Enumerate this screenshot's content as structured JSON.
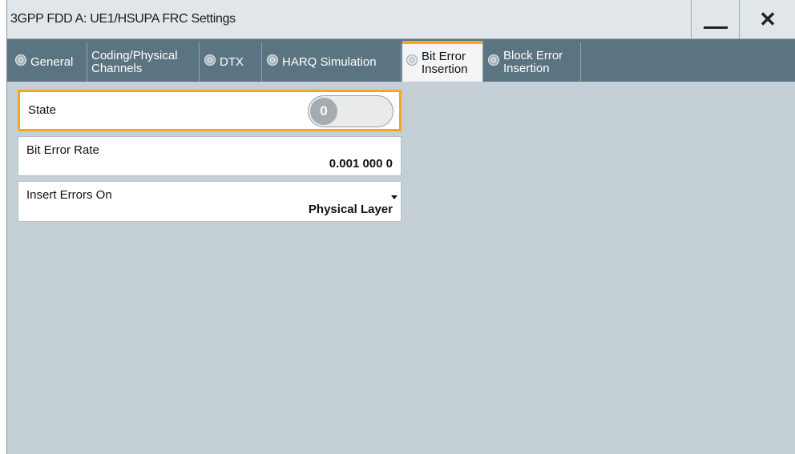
{
  "window": {
    "title": "3GPP FDD A: UE1/HSUPA FRC Settings",
    "minimize_icon": "minimize-icon",
    "close_icon": "close-icon",
    "close_glyph": "✕"
  },
  "tabs": [
    {
      "label": "General",
      "active": false
    },
    {
      "label": "Coding/Physical\nChannels",
      "active": false
    },
    {
      "label": "DTX",
      "active": false
    },
    {
      "label": "HARQ Simulation",
      "active": false
    },
    {
      "label": "Bit Error\nInsertion",
      "active": true
    },
    {
      "label": "Block Error\nInsertion",
      "active": false
    }
  ],
  "fields": {
    "state": {
      "label": "State",
      "toggle_value": "0"
    },
    "bit_error_rate": {
      "label": "Bit Error Rate",
      "value": "0.001 000 0"
    },
    "insert_errors_on": {
      "label": "Insert Errors On",
      "value": "Physical Layer"
    }
  },
  "colors": {
    "accent": "#f5a623",
    "tabbar": "#5b7482",
    "panel": "#c5cfd6"
  }
}
